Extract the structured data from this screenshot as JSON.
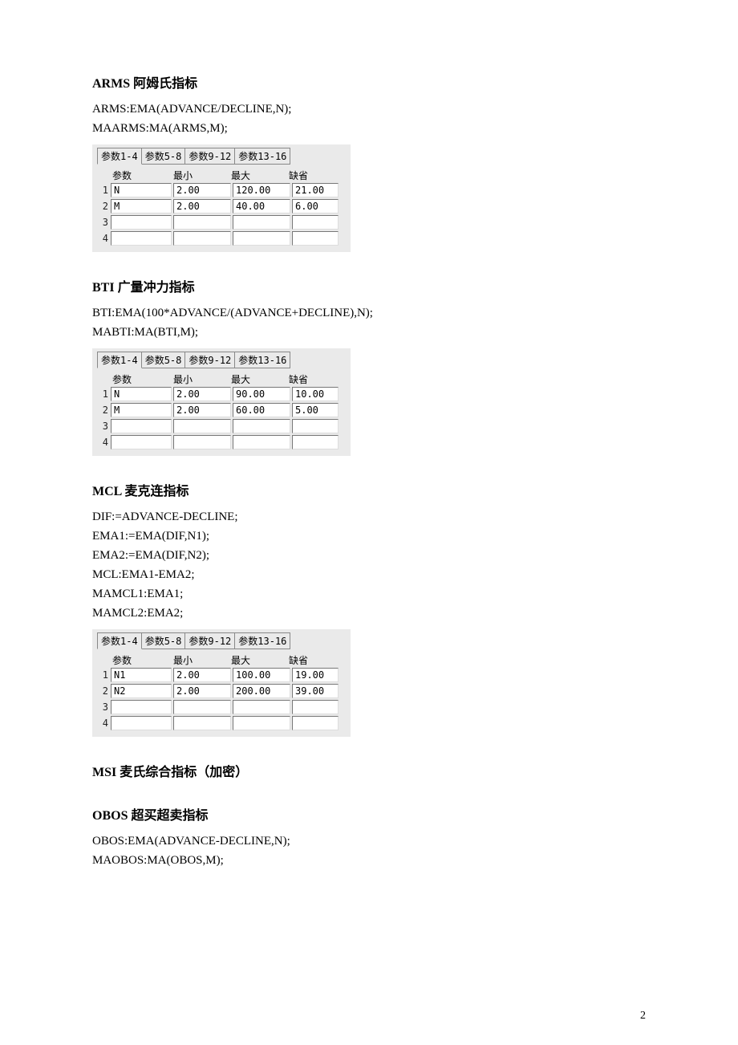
{
  "pageNumber": "2",
  "tabs": [
    "参数1-4",
    "参数5-8",
    "参数9-12",
    "参数13-16"
  ],
  "headers": {
    "param": "参数",
    "min": "最小",
    "max": "最大",
    "def": "缺省"
  },
  "sections": [
    {
      "title": "ARMS  阿姆氏指标",
      "formulas": [
        "ARMS:EMA(ADVANCE/DECLINE,N);",
        "MAARMS:MA(ARMS,M);"
      ],
      "rows": [
        {
          "idx": "1",
          "name": "N",
          "min": "2.00",
          "max": "120.00",
          "def": "21.00"
        },
        {
          "idx": "2",
          "name": "M",
          "min": "2.00",
          "max": "40.00",
          "def": "6.00"
        },
        {
          "idx": "3",
          "name": "",
          "min": "",
          "max": "",
          "def": ""
        },
        {
          "idx": "4",
          "name": "",
          "min": "",
          "max": "",
          "def": ""
        }
      ]
    },
    {
      "title": "BTI  广量冲力指标",
      "formulas": [
        "BTI:EMA(100*ADVANCE/(ADVANCE+DECLINE),N);",
        "MABTI:MA(BTI,M);"
      ],
      "rows": [
        {
          "idx": "1",
          "name": "N",
          "min": "2.00",
          "max": "90.00",
          "def": "10.00"
        },
        {
          "idx": "2",
          "name": "M",
          "min": "2.00",
          "max": "60.00",
          "def": "5.00"
        },
        {
          "idx": "3",
          "name": "",
          "min": "",
          "max": "",
          "def": ""
        },
        {
          "idx": "4",
          "name": "",
          "min": "",
          "max": "",
          "def": ""
        }
      ]
    },
    {
      "title": "MCL  麦克连指标",
      "formulas": [
        "DIF:=ADVANCE-DECLINE;",
        "EMA1:=EMA(DIF,N1);",
        "EMA2:=EMA(DIF,N2);",
        "MCL:EMA1-EMA2;",
        "MAMCL1:EMA1;",
        "MAMCL2:EMA2;"
      ],
      "rows": [
        {
          "idx": "1",
          "name": "N1",
          "min": "2.00",
          "max": "100.00",
          "def": "19.00"
        },
        {
          "idx": "2",
          "name": "N2",
          "min": "2.00",
          "max": "200.00",
          "def": "39.00"
        },
        {
          "idx": "3",
          "name": "",
          "min": "",
          "max": "",
          "def": ""
        },
        {
          "idx": "4",
          "name": "",
          "min": "",
          "max": "",
          "def": ""
        }
      ]
    },
    {
      "title": "MSI   麦氏综合指标（加密）",
      "formulas": [],
      "rows": null
    },
    {
      "title": "OBOS  超买超卖指标",
      "formulas": [
        "OBOS:EMA(ADVANCE-DECLINE,N);",
        "MAOBOS:MA(OBOS,M);"
      ],
      "rows": null
    }
  ]
}
